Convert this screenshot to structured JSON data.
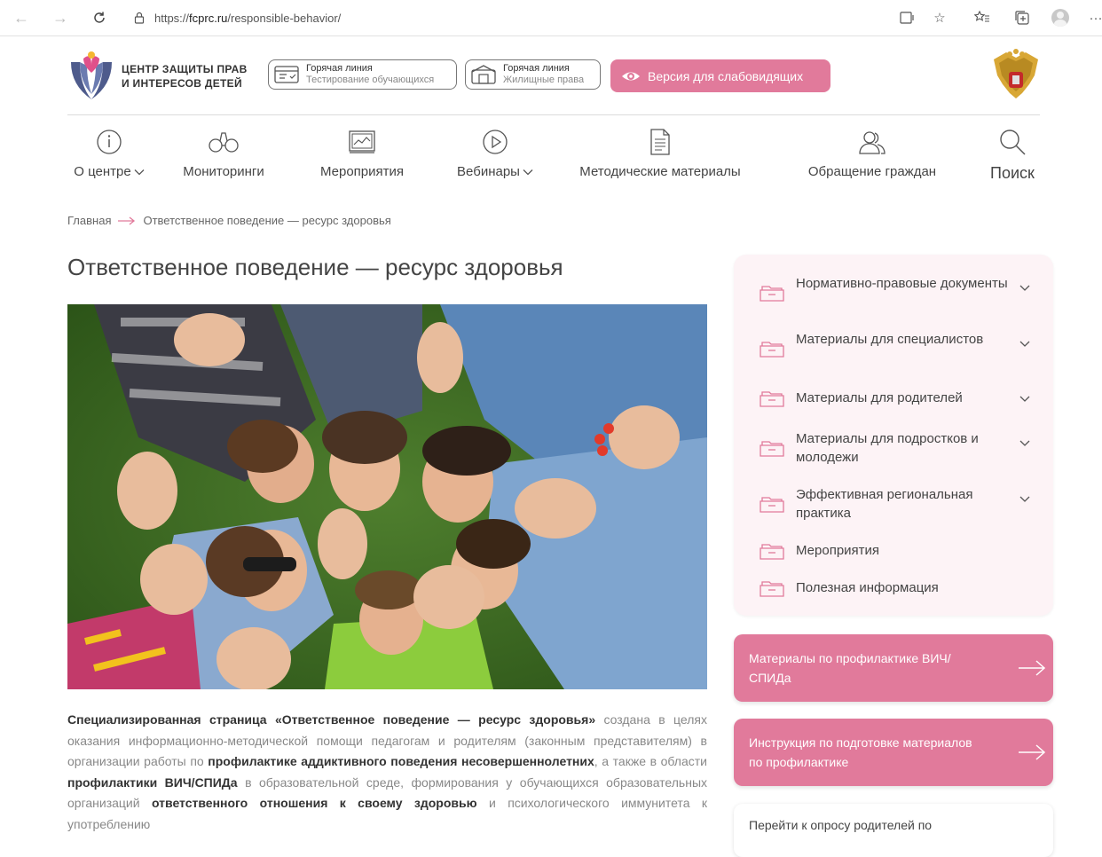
{
  "browser": {
    "url_prefix": "https://",
    "url_host": "fcprc.ru",
    "url_path": "/responsible-behavior/"
  },
  "header": {
    "logo_line1": "ЦЕНТР ЗАЩИТЫ ПРАВ",
    "logo_line2": "И ИНТЕРЕСОВ ДЕТЕЙ",
    "hotline1_title": "Горячая линия",
    "hotline1_sub": "Тестирование обучающихся",
    "hotline2_title": "Горячая линия",
    "hotline2_sub": "Жилищные права",
    "vision_label": "Версия для слабовидящих"
  },
  "menu": {
    "about": "О центре",
    "monitoring": "Мониторинги",
    "events": "Мероприятия",
    "webinars": "Вебинары",
    "methods": "Методические материалы",
    "appeals": "Обращение граждан",
    "search": "Поиск"
  },
  "breadcrumb": {
    "home": "Главная",
    "current": "Ответственное поведение — ресурс здоровья"
  },
  "page": {
    "title": "Ответственное поведение — ресурс здоровья"
  },
  "article": {
    "p1_b1": "Специализированная страница «Ответственное поведение — ресурс здоровья»",
    "p1_t1": " создана в целях оказания информационно-методической помощи педагогам и родителям (законным представителям) в организации работы по ",
    "p1_b2": "профилактике аддиктивного поведения несовершеннолетних",
    "p1_t2": ", а также в области ",
    "p1_b3": "профилактики ВИЧ/СПИДа",
    "p1_t3": " в образовательной среде, формирования у обучающихся образовательных организаций ",
    "p1_b4": "ответственного отношения к своему здоровью",
    "p1_t4": " и психологического иммунитета к употреблению"
  },
  "sidebar": {
    "items": [
      {
        "label": "Нормативно-правовые документы"
      },
      {
        "label": "Материалы для специалистов"
      },
      {
        "label": "Материалы для родителей"
      },
      {
        "label": "Материалы для подростков и молодежи"
      },
      {
        "label": "Эффективная региональная практика"
      },
      {
        "label": "Мероприятия"
      },
      {
        "label": "Полезная информация"
      }
    ],
    "card1": "Материалы по профилактике ВИЧ/СПИДа",
    "card2": "Инструкция по подготовке материалов по профилактике",
    "card3": "Перейти к опросу родителей по"
  },
  "colors": {
    "accent": "#e17a9b",
    "sidebar_bg": "#fdf3f6"
  }
}
